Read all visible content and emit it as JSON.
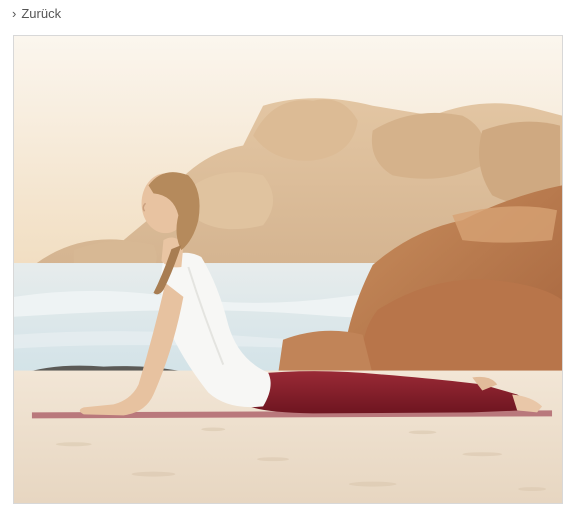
{
  "nav": {
    "back_label": "Zurück",
    "back_icon": "chevron-right-icon"
  },
  "image": {
    "subject": "woman-yoga-cobra-pose-beach",
    "colors": {
      "sky": "#f6ead8",
      "sea": "#cfe0e6",
      "rock": "#c9a27c",
      "sand": "#efe3d2",
      "top": "#f7f7f5",
      "pants": "#8a1f2b",
      "mat": "#b9787c"
    }
  }
}
